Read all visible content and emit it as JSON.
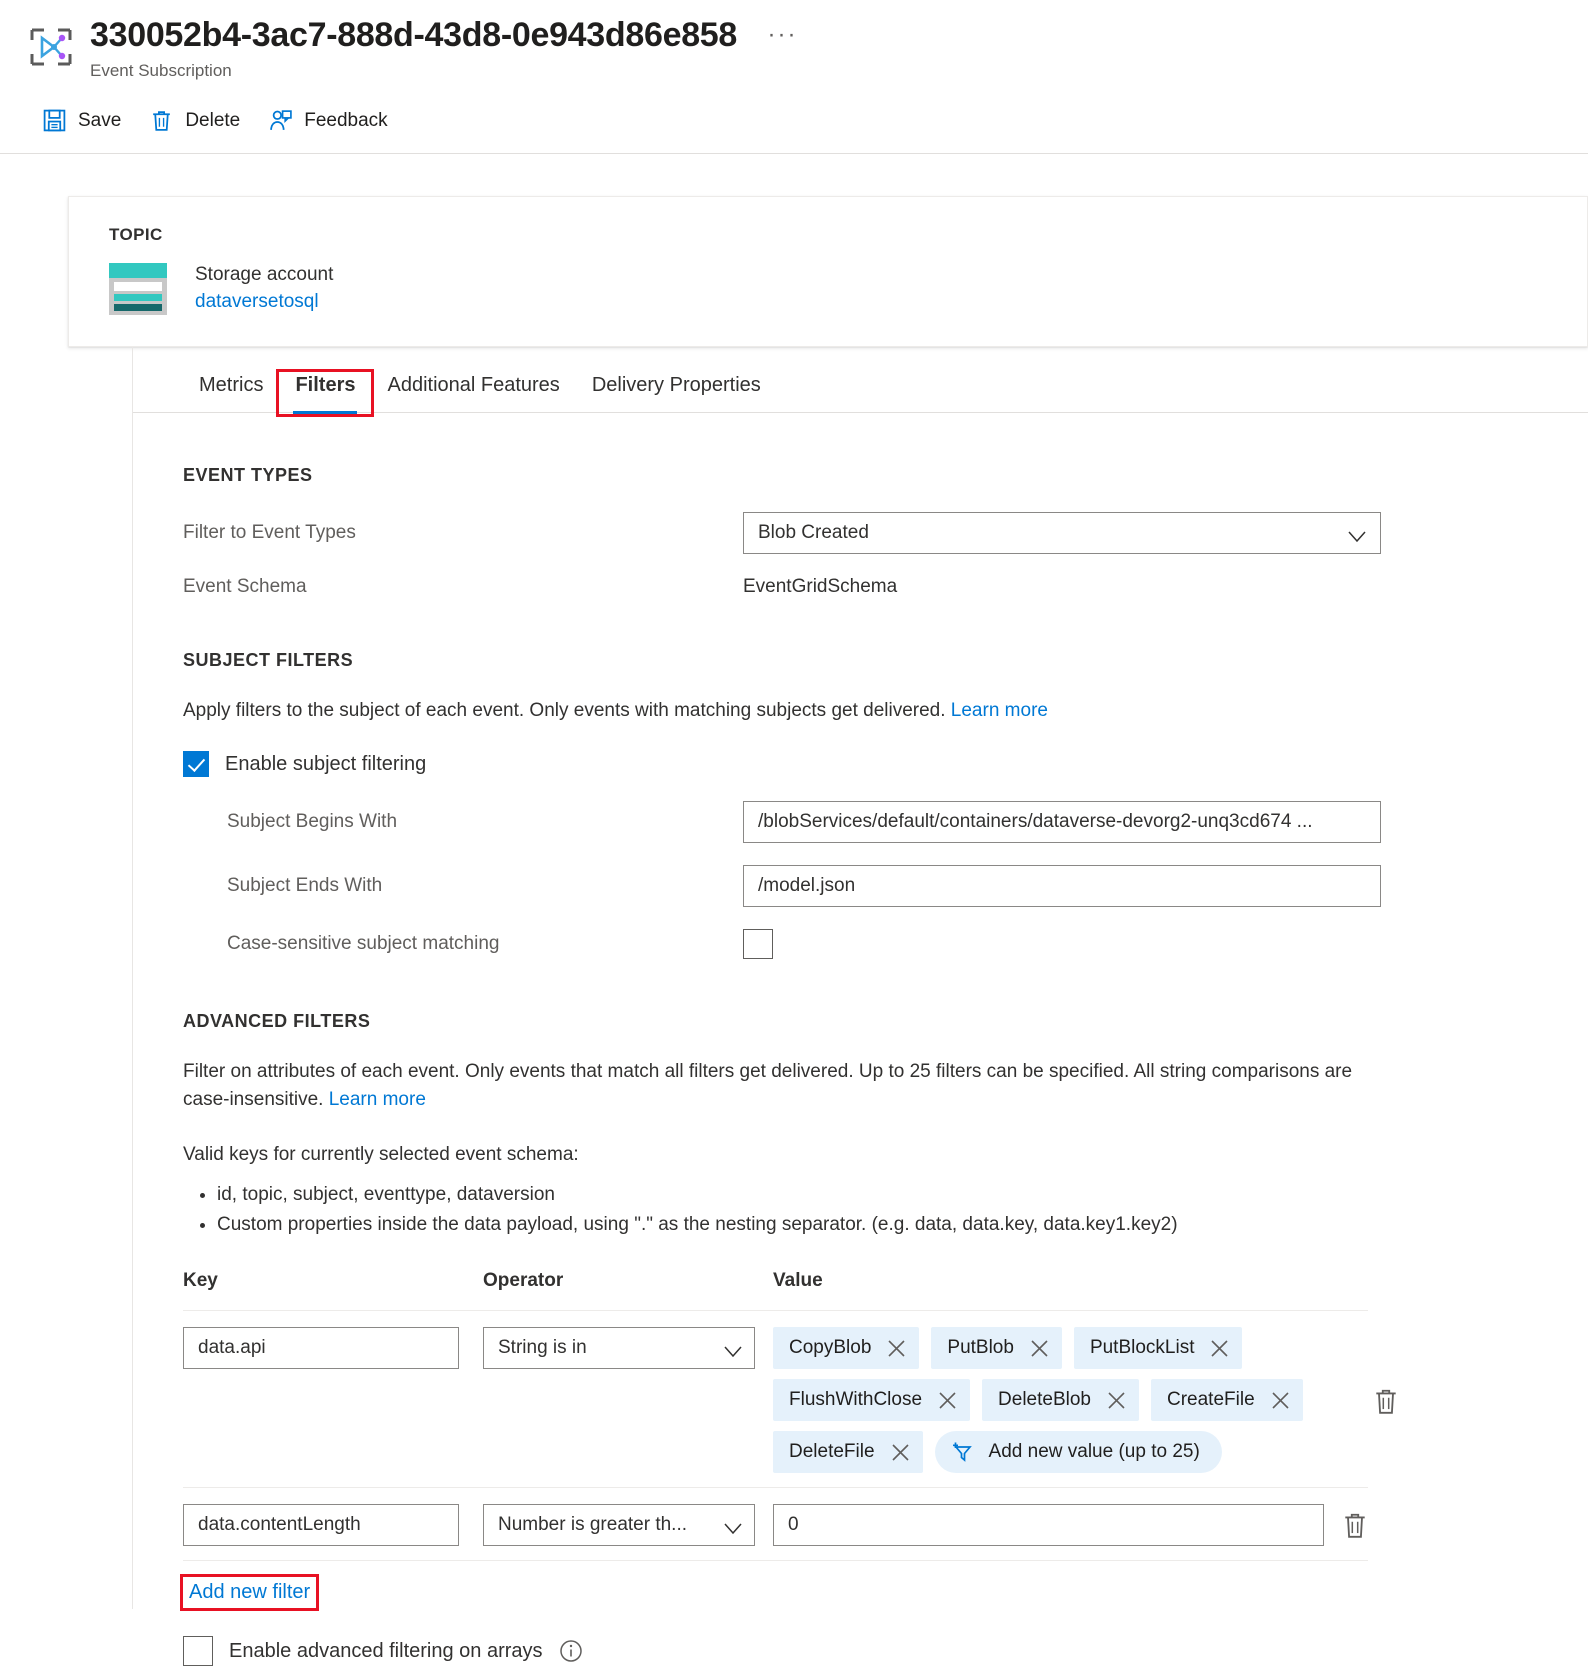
{
  "header": {
    "title": "330052b4-3ac7-888d-43d8-0e943d86e858",
    "subtitle": "Event Subscription",
    "more_label": "···",
    "icon": "event-subscription-icon"
  },
  "command_bar": {
    "items": [
      {
        "label": "Save",
        "icon": "save-icon"
      },
      {
        "label": "Delete",
        "icon": "trash-icon"
      },
      {
        "label": "Feedback",
        "icon": "feedback-person-icon"
      }
    ]
  },
  "topic_card": {
    "label": "TOPIC",
    "kind": "Storage account",
    "name": "dataversetosql",
    "icon": "storage-account-icon"
  },
  "tabs": [
    {
      "label": "Metrics",
      "active": false,
      "annotated": false
    },
    {
      "label": "Filters",
      "active": true,
      "annotated": true
    },
    {
      "label": "Additional Features",
      "active": false,
      "annotated": false
    },
    {
      "label": "Delivery Properties",
      "active": false,
      "annotated": false
    }
  ],
  "event_types": {
    "heading": "EVENT TYPES",
    "filter_label": "Filter to Event Types",
    "filter_value": "Blob Created",
    "schema_label": "Event Schema",
    "schema_value": "EventGridSchema"
  },
  "subject_filters": {
    "heading": "SUBJECT FILTERS",
    "description": "Apply filters to the subject of each event. Only events with matching subjects get delivered. ",
    "learn_more": "Learn more",
    "enable_label": "Enable subject filtering",
    "enable_checked": true,
    "begins_label": "Subject Begins With",
    "begins_value": "/blobServices/default/containers/dataverse-devorg2-unq3cd674 ...",
    "ends_label": "Subject Ends With",
    "ends_value": "/model.json",
    "case_label": "Case-sensitive subject matching",
    "case_checked": false
  },
  "advanced_filters": {
    "heading": "ADVANCED FILTERS",
    "description": "Filter on attributes of each event. Only events that match all filters get delivered. Up to 25 filters can be specified. All string comparisons are case-insensitive. ",
    "learn_more": "Learn more",
    "valid_keys_intro": "Valid keys for currently selected event schema:",
    "valid_keys": [
      "id, topic, subject, eventtype, dataversion",
      "Custom properties inside the data payload, using \".\" as the nesting separator. (e.g. data, data.key, data.key1.key2)"
    ],
    "columns": {
      "key": "Key",
      "operator": "Operator",
      "value": "Value"
    },
    "rows": [
      {
        "key": "data.api",
        "operator": "String is in",
        "value_type": "chips",
        "chips": [
          "CopyBlob",
          "PutBlob",
          "PutBlockList",
          "FlushWithClose",
          "DeleteBlob",
          "CreateFile",
          "DeleteFile"
        ],
        "add_value_label": "Add new value (up to 25)"
      },
      {
        "key": "data.contentLength",
        "operator": "Number is greater th...",
        "value_type": "text",
        "value": "0"
      }
    ],
    "add_filter_label": "Add new filter",
    "arrays_label": "Enable advanced filtering on arrays",
    "arrays_checked": false
  },
  "colors": {
    "accent": "#0078d4",
    "annotation": "#e81123",
    "chip_bg": "#e5f1fb",
    "storage_teal": "#32c8c0"
  }
}
